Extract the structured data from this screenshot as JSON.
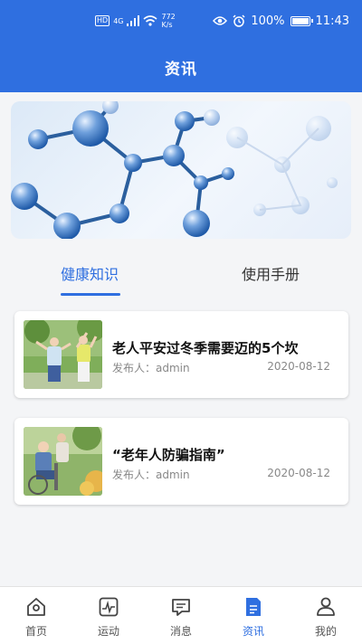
{
  "status_bar": {
    "hd": "HD",
    "network": "4G",
    "speed_value": "772",
    "speed_unit": "K/s",
    "battery": "100%",
    "time": "11:43"
  },
  "header": {
    "title": "资讯"
  },
  "tabs": [
    {
      "label": "健康知识",
      "active": true
    },
    {
      "label": "使用手册",
      "active": false
    }
  ],
  "articles": [
    {
      "title": "老人平安过冬季需要迈的5个坎",
      "publisher": "发布人：admin",
      "date": "2020-08-12"
    },
    {
      "title": "“老年人防骗指南”",
      "publisher": "发布人：admin",
      "date": "2020-08-12"
    }
  ],
  "bottom_nav": [
    {
      "label": "首页",
      "icon": "home-icon",
      "active": false
    },
    {
      "label": "运动",
      "icon": "activity-icon",
      "active": false
    },
    {
      "label": "消息",
      "icon": "message-icon",
      "active": false
    },
    {
      "label": "资讯",
      "icon": "news-icon",
      "active": true
    },
    {
      "label": "我的",
      "icon": "profile-icon",
      "active": false
    }
  ],
  "colors": {
    "primary": "#2f6fe0",
    "background": "#f4f5f7"
  }
}
